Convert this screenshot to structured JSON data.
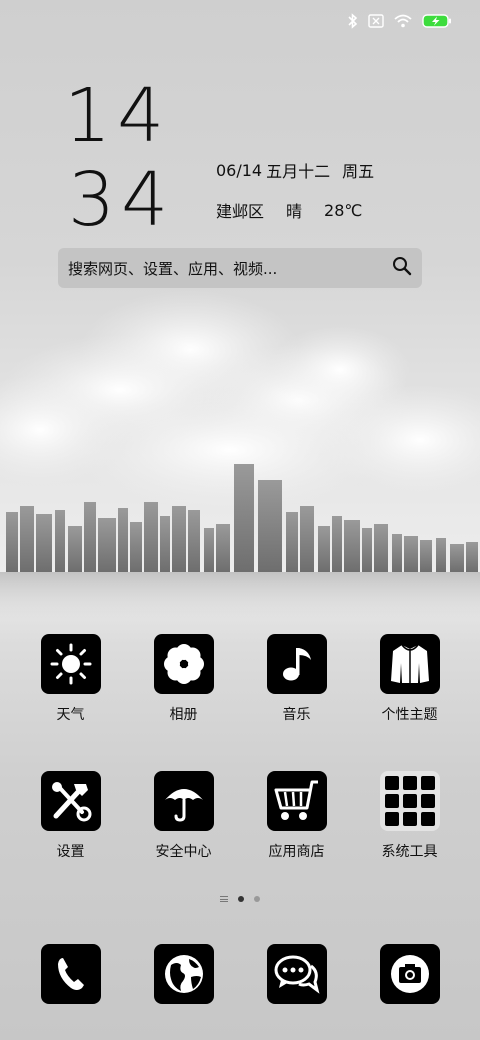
{
  "status_bar": {
    "icons": [
      "bluetooth-icon",
      "no-sim-icon",
      "wifi-icon",
      "battery-charging-icon"
    ],
    "battery_color": "#3ddc3d"
  },
  "clock": {
    "hours": "14",
    "minutes": "34"
  },
  "info": {
    "date": "06/14",
    "lunar": "五月十二",
    "weekday": "周五",
    "district": "建邺区",
    "weather": "晴",
    "temperature": "28℃"
  },
  "search": {
    "placeholder": "搜索网页、设置、应用、视频..."
  },
  "apps_row1": [
    {
      "label": "天气",
      "icon": "sun-icon"
    },
    {
      "label": "相册",
      "icon": "flower-icon"
    },
    {
      "label": "音乐",
      "icon": "music-note-icon"
    },
    {
      "label": "个性主题",
      "icon": "jacket-icon"
    }
  ],
  "apps_row2": [
    {
      "label": "设置",
      "icon": "tools-icon"
    },
    {
      "label": "安全中心",
      "icon": "umbrella-icon"
    },
    {
      "label": "应用商店",
      "icon": "shopping-cart-icon"
    },
    {
      "label": "系统工具",
      "icon": "folder-icon"
    }
  ],
  "pager": {
    "pages": 2,
    "active": 1
  },
  "dock": [
    {
      "icon": "phone-icon"
    },
    {
      "icon": "globe-icon"
    },
    {
      "icon": "messages-icon"
    },
    {
      "icon": "camera-icon"
    }
  ]
}
